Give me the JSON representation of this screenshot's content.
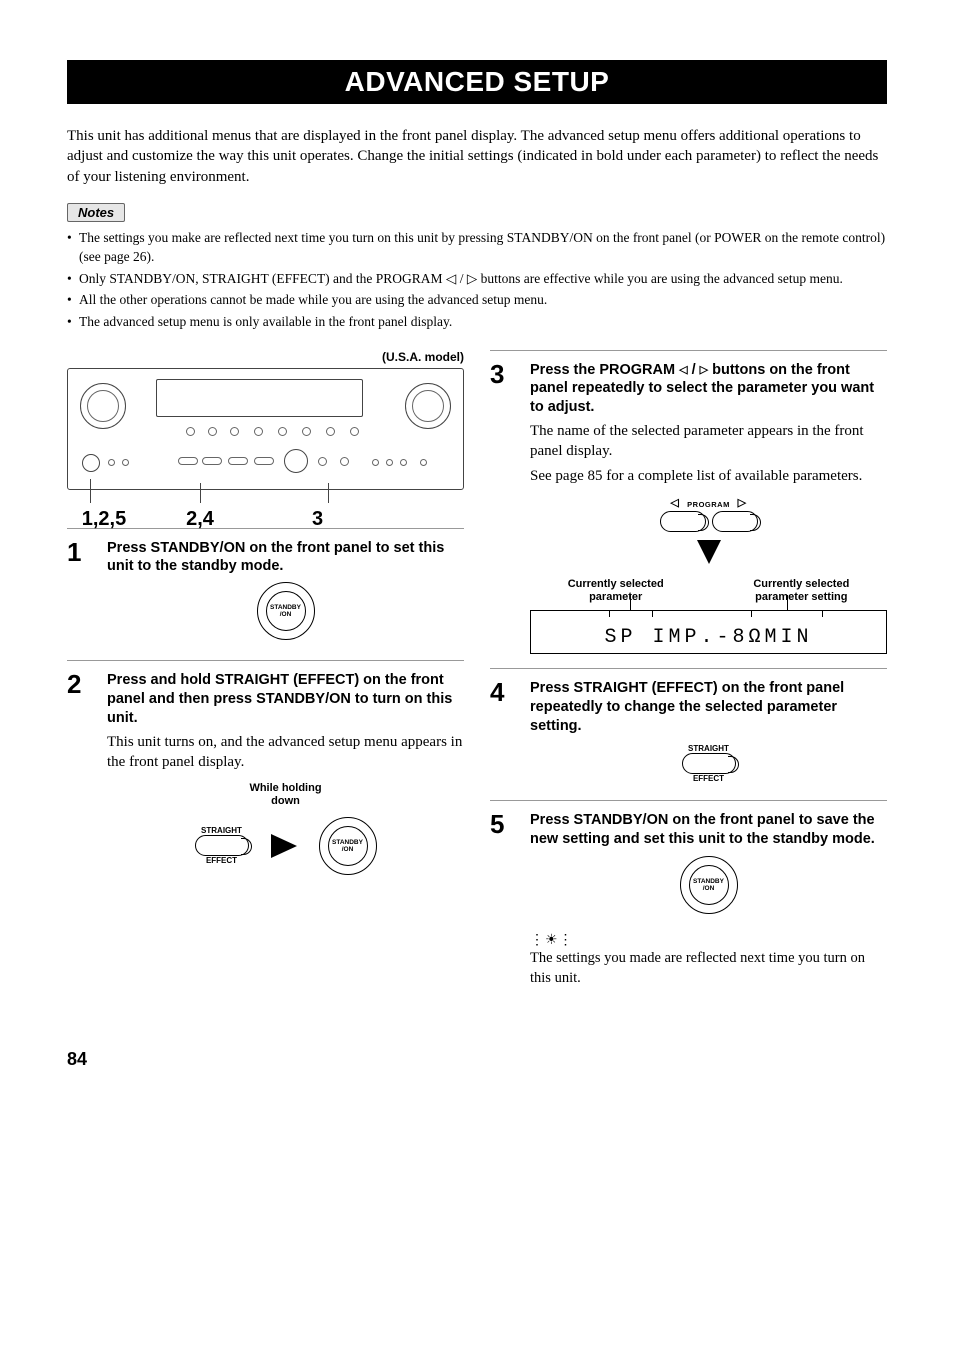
{
  "title": "ADVANCED SETUP",
  "intro": "This unit has additional menus that are displayed in the front panel display. The advanced setup menu offers additional operations to adjust and customize the way this unit operates. Change the initial settings (indicated in bold under each parameter) to reflect the needs of your listening environment.",
  "notes_label": "Notes",
  "notes": [
    "The settings you make are reflected next time you turn on this unit by pressing STANDBY/ON on the front panel (or POWER on the remote control) (see page 26).",
    "Only STANDBY/ON, STRAIGHT (EFFECT) and the PROGRAM ◁ / ▷ buttons are effective while you are using the advanced setup menu.",
    "All the other operations cannot be made while you are using the advanced setup menu.",
    "The advanced setup menu is only available in the front panel display."
  ],
  "model_label": "(U.S.A. model)",
  "callout_1": "1,2,5",
  "callout_2": "2,4",
  "callout_3": "3",
  "steps": {
    "s1": {
      "num": "1",
      "head": "Press STANDBY/ON on the front panel to set this unit to the standby mode."
    },
    "s2": {
      "num": "2",
      "head": "Press and hold STRAIGHT (EFFECT) on the front panel and then press STANDBY/ON to turn on this unit.",
      "text": "This unit turns on, and the advanced setup menu appears in the front panel display.",
      "hold_label": "While holding\ndown"
    },
    "s3": {
      "num": "3",
      "head_a": "Press the PROGRAM ",
      "head_b": " buttons on the front panel repeatedly to select the parameter you want to adjust.",
      "text1": "The name of the selected parameter appears in the front panel display.",
      "text2": "See page 85 for a complete list of available parameters.",
      "sel_param": "Currently selected\nparameter",
      "sel_setting": "Currently selected\nparameter setting",
      "lcd": "SP IMP.-8ΩMIN",
      "program_label": "PROGRAM"
    },
    "s4": {
      "num": "4",
      "head": "Press STRAIGHT (EFFECT) on the front panel repeatedly to change the selected parameter setting."
    },
    "s5": {
      "num": "5",
      "head": "Press STANDBY/ON on the front panel to save the new setting and set this unit to the standby mode."
    }
  },
  "btn_labels": {
    "straight_top": "STRAIGHT",
    "straight_bottom": "EFFECT",
    "standby": "STANDBY\n/ON"
  },
  "tip": "The settings you made are reflected next time you turn on this unit.",
  "page_number": "84"
}
